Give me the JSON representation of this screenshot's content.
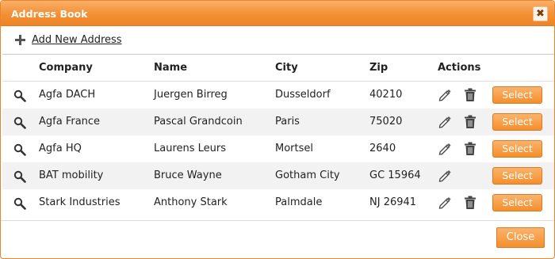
{
  "dialog": {
    "title": "Address Book",
    "close_glyph": "✖"
  },
  "toolbar": {
    "add_label": "Add New Address",
    "add_icon": "plus-icon"
  },
  "table": {
    "headers": {
      "company": "Company",
      "name": "Name",
      "city": "City",
      "zip": "Zip",
      "actions": "Actions"
    },
    "rows": [
      {
        "company": "Agfa DACH",
        "name": "Juergen Birreg",
        "city": "Dusseldorf",
        "zip": "40210",
        "can_delete": true,
        "select_label": "Select"
      },
      {
        "company": "Agfa France",
        "name": "Pascal Grandcoin",
        "city": "Paris",
        "zip": "75020",
        "can_delete": true,
        "select_label": "Select"
      },
      {
        "company": "Agfa HQ",
        "name": "Laurens Leurs",
        "city": "Mortsel",
        "zip": "2640",
        "can_delete": true,
        "select_label": "Select"
      },
      {
        "company": "BAT mobility",
        "name": "Bruce Wayne",
        "city": "Gotham City",
        "zip": "GC 15964",
        "can_delete": false,
        "select_label": "Select"
      },
      {
        "company": "Stark Industries",
        "name": "Anthony Stark",
        "city": "Palmdale",
        "zip": "NJ 26941",
        "can_delete": true,
        "select_label": "Select"
      }
    ]
  },
  "footer": {
    "close_label": "Close"
  },
  "colors": {
    "accent": "#f39033",
    "button": "#f48f2d"
  }
}
